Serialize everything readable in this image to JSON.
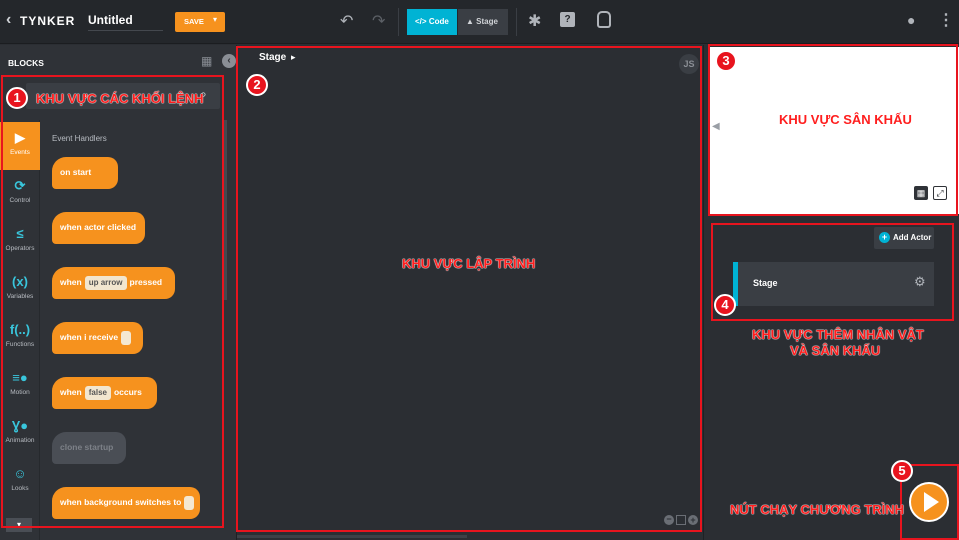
{
  "topbar": {
    "logo": "TYNKER",
    "project_title": "Untitled",
    "save_label": "SAVE",
    "code_tab": "Code",
    "stage_tab": "Stage"
  },
  "sidebar": {
    "title": "BLOCKS",
    "search_annotation": "KHU VỰC CÁC KHỐI LỆNH",
    "section_title": "Event Handlers",
    "categories": [
      {
        "label": "Events",
        "icon": "▶"
      },
      {
        "label": "Control",
        "icon": "⟳"
      },
      {
        "label": "Operators",
        "icon": "≤"
      },
      {
        "label": "Variables",
        "icon": "(x)"
      },
      {
        "label": "Functions",
        "icon": "f(..)"
      },
      {
        "label": "Motion",
        "icon": "≡●"
      },
      {
        "label": "Animation",
        "icon": "Ɣ●"
      },
      {
        "label": "Looks",
        "icon": "☺"
      }
    ],
    "blocks": [
      {
        "text": "on start"
      },
      {
        "text": "when actor clicked"
      },
      {
        "pre": "when",
        "slot": "up arrow",
        "post": "pressed"
      },
      {
        "pre": "when i receive"
      },
      {
        "pre": "when",
        "slot": "false",
        "post": "occurs"
      },
      {
        "text": "clone startup"
      },
      {
        "pre": "when background switches to"
      }
    ]
  },
  "workspace": {
    "breadcrumb": "Stage",
    "js_label": "JS",
    "annotation": "KHU VỰC LẬP TRÌNH"
  },
  "stage_panel": {
    "annotation": "KHU VỰC SÂN KHẤU"
  },
  "actors": {
    "add_actor_label": "Add Actor",
    "items": [
      {
        "name": "Stage"
      }
    ],
    "annotation_line1": "KHU VỰC THÊM NHÂN VẬT",
    "annotation_line2": "VÀ SÂN KHẤU"
  },
  "run": {
    "annotation": "NÚT CHẠY CHƯƠNG TRÌNH"
  },
  "badges": [
    "1",
    "2",
    "3",
    "4",
    "5"
  ],
  "colors": {
    "accent_orange": "#f6921e",
    "accent_cyan": "#00b3d4",
    "annotation_red": "#e8141e"
  }
}
